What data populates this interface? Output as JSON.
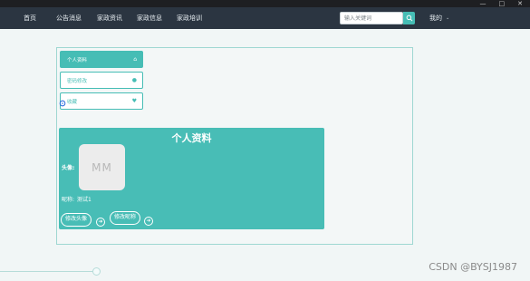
{
  "window": {
    "controls": [
      "—",
      "□",
      "✕"
    ]
  },
  "navbar": {
    "items": [
      "首页",
      "公告消息",
      "家政资讯",
      "家政信息",
      "家政培训"
    ],
    "search_placeholder": "输入关键词",
    "me_label": "我的",
    "me_caret": "⌄"
  },
  "sidebar": {
    "items": [
      {
        "label": "个人资料",
        "icon": "home-icon",
        "active": true
      },
      {
        "label": "密码修改",
        "icon": "user-icon",
        "active": false
      },
      {
        "label": "收藏",
        "icon": "heart-icon",
        "active": false
      }
    ]
  },
  "profile": {
    "title": "个人资料",
    "avatar_label": "头像:",
    "avatar_placeholder": "MM",
    "nickname_label": "昵称:",
    "nickname_value": "测试1",
    "change_avatar_label": "修改头像",
    "change_nickname_label": "修改昵称"
  },
  "colors": {
    "accent": "#46bdb5",
    "navbar": "#2b3541"
  },
  "watermark": "CSDN @BYSJ1987"
}
